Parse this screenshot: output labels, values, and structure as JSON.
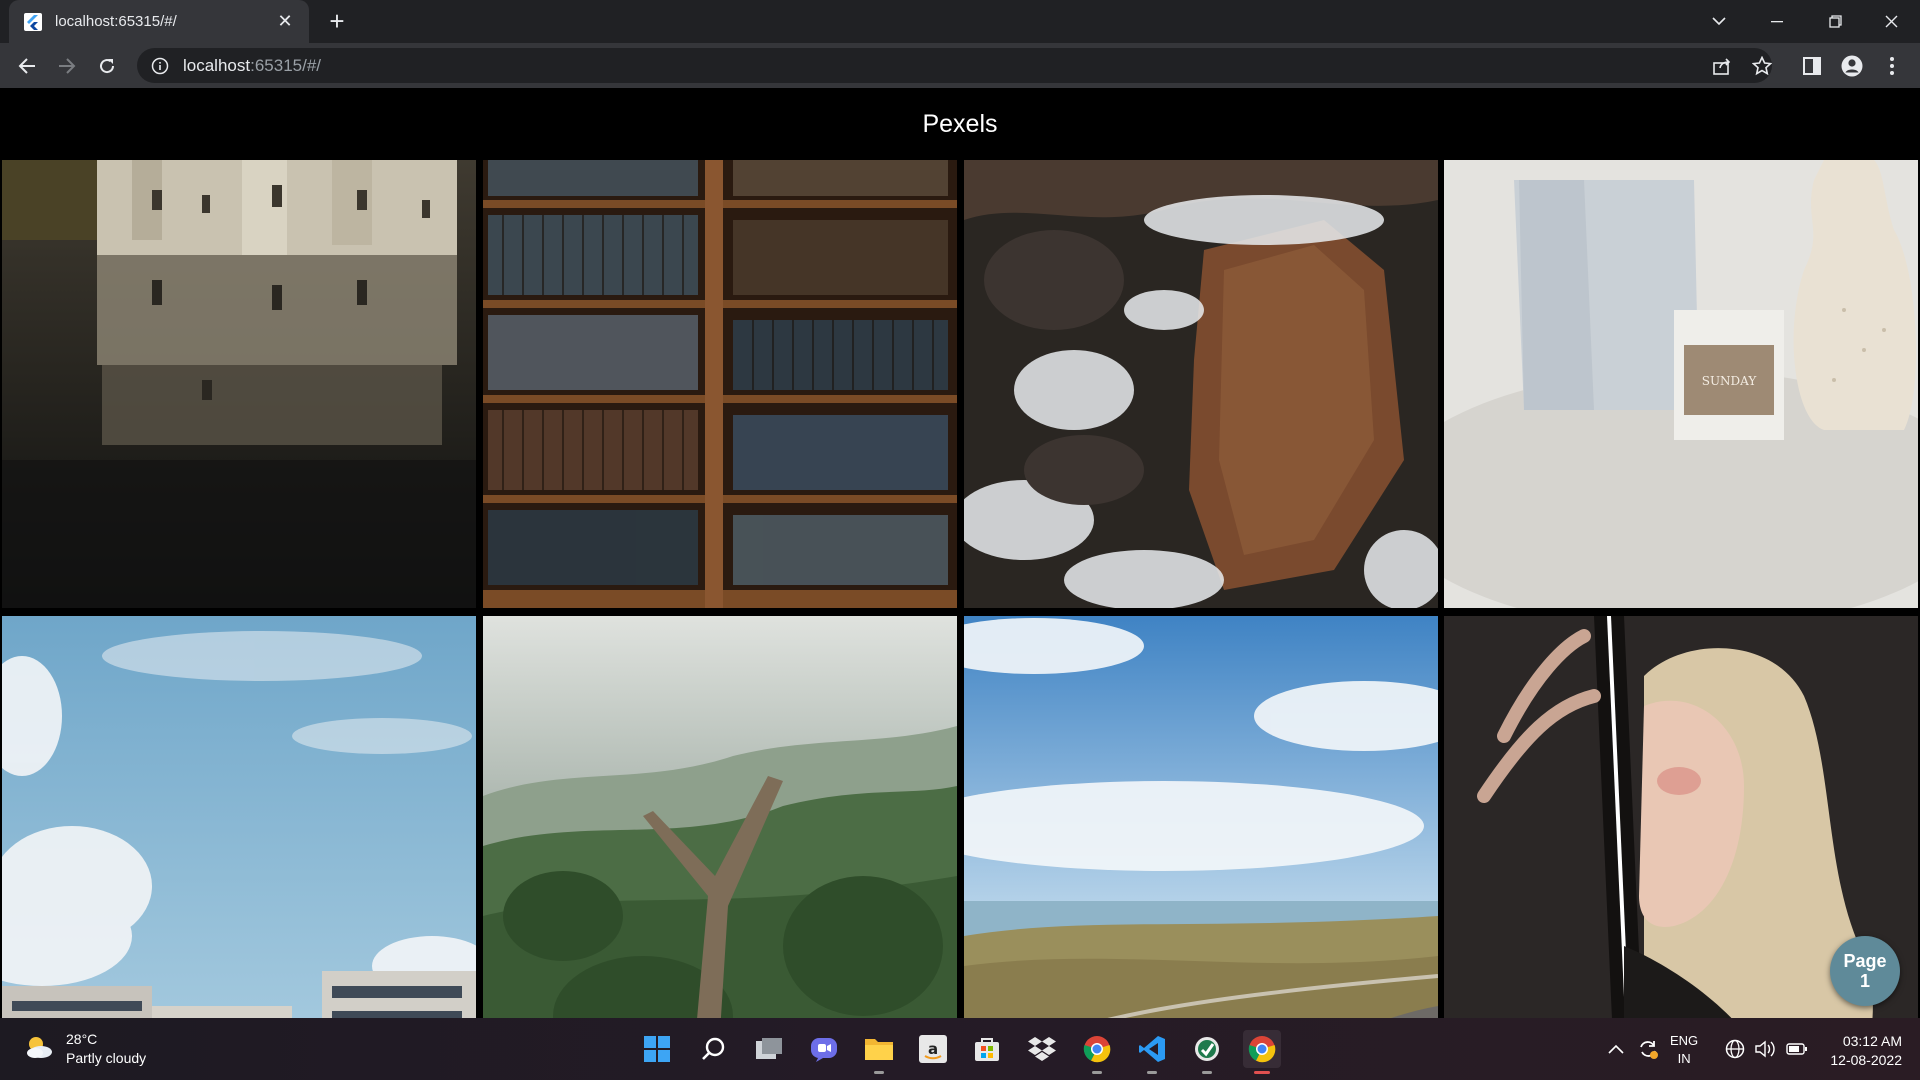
{
  "browser": {
    "tab_title": "localhost:65315/#/",
    "tab_close_glyph": "✕",
    "new_tab_glyph": "+",
    "url_host": "localhost",
    "url_rest": ":65315/#/"
  },
  "app": {
    "title": "Pexels",
    "photos": [
      {
        "subject": "castle reflected in lake"
      },
      {
        "subject": "library bookshelves"
      },
      {
        "subject": "rock in foaming water"
      },
      {
        "subject": "candle and ceramic vase"
      },
      {
        "subject": "sky with clouds over buildings"
      },
      {
        "subject": "forked wooden branch over forest"
      },
      {
        "subject": "coastline under blue sky"
      },
      {
        "subject": "portrait with light beam"
      }
    ],
    "page_fab": {
      "label": "Page",
      "number": "1"
    }
  },
  "taskbar": {
    "weather_temp": "28°C",
    "weather_desc": "Partly cloudy",
    "lang_top": "ENG",
    "lang_bottom": "IN",
    "time": "03:12 AM",
    "date": "12-08-2022",
    "apps": [
      "windows-start",
      "search",
      "task-view",
      "chat",
      "file-explorer",
      "amazon",
      "microsoft-store",
      "dropbox",
      "chrome",
      "vscode",
      "app-pinned",
      "chrome-active"
    ]
  },
  "colors": {
    "chrome_dark": "#202124",
    "chrome_toolbar": "#35363a",
    "fab": "#5f8a99"
  }
}
